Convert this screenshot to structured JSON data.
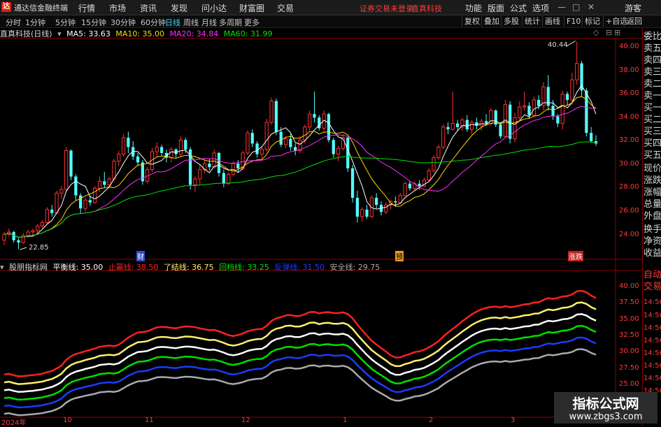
{
  "menubar": {
    "logo_glyph": "达",
    "app_title": "通达信金融终端",
    "items": [
      "行情",
      "市场",
      "资讯",
      "发现",
      "问小达",
      "财富圈",
      "交易"
    ],
    "alert_1": "证券交易未登录",
    "alert_2": "直真科技",
    "right_items": [
      "功能",
      "版面",
      "公式",
      "选项"
    ],
    "user": "游客",
    "win_min": "—",
    "win_max": "□",
    "win_close": "✕"
  },
  "toolbar": {
    "timeframes": [
      "分时",
      "1分钟",
      "5分钟",
      "15分钟",
      "30分钟",
      "60分钟",
      "日线",
      "周线",
      "月线",
      "多周期",
      "更多"
    ],
    "active": "日线",
    "right_buttons": [
      "复权",
      "叠加",
      "多股",
      "统计",
      "画线",
      "F10",
      "标记",
      "+自选",
      "返回"
    ]
  },
  "main_header": {
    "title": "直真科技(日线)",
    "ma5": "MA5: 33.63",
    "ma10": "MA10: 35.00",
    "ma20": "MA20: 34.84",
    "ma60": "MA60: 31.99",
    "colors": {
      "ma5": "#ffffff",
      "ma10": "#ffd700",
      "ma20": "#ff2bff",
      "ma60": "#00e000"
    }
  },
  "price_axis": [
    "40.00",
    "38.00",
    "36.00",
    "34.00",
    "32.00",
    "30.00",
    "28.00",
    "26.00",
    "24.00"
  ],
  "annotations": {
    "high": "40.44",
    "low": "22.85",
    "marker_1": "财",
    "marker_2": "预",
    "marker_3": "涨跌"
  },
  "sub_header": {
    "title": "股朋指标网",
    "balance": "平衡线: 35.00",
    "stop_profit": "止赢线: 38.50",
    "close_out": "了结线: 36.75",
    "pullback": "回档线: 33.25",
    "rebound": "反弹线: 31.50",
    "safe": "安全线: 29.75",
    "colors": {
      "stop_profit": "#ff2020",
      "close_out": "#ffef6a",
      "balance": "#ffffff",
      "pullback": "#00e000",
      "rebound": "#1a3cff",
      "safe": "#aaaaaa"
    }
  },
  "sub_axis": [
    "40.00",
    "37.50",
    "35.00",
    "32.50",
    "30.00",
    "27.50",
    "25.00"
  ],
  "right_panel": {
    "items": [
      "委比",
      "卖五",
      "卖四",
      "卖三",
      "卖二",
      "卖一",
      "买一",
      "买二",
      "买三",
      "买四",
      "买五",
      "现价",
      "涨跌",
      "涨幅",
      "总量",
      "外盘",
      "换手",
      "净资",
      "收益"
    ],
    "bottom_items": [
      "自动",
      "交易"
    ],
    "time_labels": [
      "14:56",
      "14:56",
      "14:56",
      "14:56",
      "14:56",
      "14:56",
      "14:56",
      "14:56"
    ]
  },
  "date_axis": [
    "2024年",
    "10",
    "11",
    "12",
    "1",
    "2",
    "3"
  ],
  "watermark": {
    "line1": "指标公式网",
    "line2": "www.zbgs3.com"
  },
  "chart_data": {
    "type": "candlestick",
    "title": "直真科技(日线)",
    "y_range": [
      23,
      41
    ],
    "candles": [
      [
        23.6,
        24.3,
        23.2,
        24.1
      ],
      [
        24.1,
        24.6,
        23.9,
        24.3
      ],
      [
        24.3,
        24.4,
        23.4,
        23.6
      ],
      [
        23.6,
        23.8,
        22.85,
        23.4
      ],
      [
        23.4,
        24.2,
        23.3,
        24.0
      ],
      [
        24.0,
        24.5,
        23.8,
        24.3
      ],
      [
        24.3,
        24.6,
        24.0,
        24.4
      ],
      [
        24.4,
        25.0,
        24.2,
        24.8
      ],
      [
        24.8,
        25.3,
        24.6,
        25.1
      ],
      [
        25.1,
        26.4,
        25.0,
        26.2
      ],
      [
        26.2,
        26.6,
        25.6,
        25.9
      ],
      [
        25.9,
        27.8,
        25.8,
        27.6
      ],
      [
        27.6,
        28.2,
        27.1,
        27.9
      ],
      [
        27.9,
        31.5,
        27.7,
        31.2
      ],
      [
        31.2,
        31.3,
        28.7,
        29.0
      ],
      [
        29.0,
        29.2,
        27.0,
        27.4
      ],
      [
        27.4,
        27.6,
        25.9,
        26.3
      ],
      [
        26.3,
        27.2,
        26.0,
        27.0
      ],
      [
        27.0,
        27.4,
        26.5,
        26.8
      ],
      [
        26.8,
        28.2,
        26.7,
        28.0
      ],
      [
        28.0,
        29.0,
        27.7,
        28.6
      ],
      [
        28.6,
        29.4,
        28.0,
        28.3
      ],
      [
        28.3,
        29.0,
        28.0,
        28.8
      ],
      [
        28.8,
        30.5,
        28.6,
        30.3
      ],
      [
        30.3,
        31.2,
        29.9,
        30.9
      ],
      [
        30.9,
        32.6,
        30.7,
        32.3
      ],
      [
        32.3,
        32.8,
        31.0,
        31.5
      ],
      [
        31.5,
        32.0,
        30.4,
        30.7
      ],
      [
        30.7,
        31.0,
        29.9,
        30.2
      ],
      [
        30.2,
        30.4,
        28.3,
        28.6
      ],
      [
        28.6,
        29.8,
        28.4,
        29.6
      ],
      [
        29.6,
        31.4,
        29.4,
        31.1
      ],
      [
        31.1,
        31.9,
        30.7,
        31.5
      ],
      [
        31.5,
        31.7,
        30.8,
        31.0
      ],
      [
        31.0,
        31.3,
        30.2,
        30.6
      ],
      [
        30.6,
        31.5,
        30.2,
        31.3
      ],
      [
        31.3,
        31.4,
        30.6,
        30.9
      ],
      [
        30.9,
        32.4,
        30.7,
        32.1
      ],
      [
        32.1,
        32.3,
        31.0,
        31.3
      ],
      [
        31.3,
        31.5,
        27.9,
        28.3
      ],
      [
        28.3,
        29.0,
        27.7,
        28.8
      ],
      [
        28.8,
        30.0,
        28.3,
        29.6
      ],
      [
        29.6,
        30.4,
        29.3,
        30.1
      ],
      [
        30.1,
        30.5,
        29.5,
        29.8
      ],
      [
        29.8,
        31.3,
        29.7,
        31.0
      ],
      [
        31.0,
        31.1,
        29.0,
        29.3
      ],
      [
        29.3,
        29.6,
        28.1,
        28.4
      ],
      [
        28.4,
        29.4,
        28.3,
        29.2
      ],
      [
        29.2,
        30.3,
        29.0,
        30.1
      ],
      [
        30.1,
        30.4,
        29.4,
        29.7
      ],
      [
        29.7,
        31.2,
        29.5,
        31.0
      ],
      [
        31.0,
        32.9,
        30.8,
        32.7
      ],
      [
        32.7,
        33.0,
        31.5,
        31.8
      ],
      [
        31.8,
        32.0,
        30.6,
        30.9
      ],
      [
        30.9,
        31.5,
        30.5,
        31.3
      ],
      [
        31.3,
        33.9,
        31.1,
        33.6
      ],
      [
        33.6,
        35.7,
        33.4,
        35.4
      ],
      [
        35.4,
        35.6,
        32.5,
        32.8
      ],
      [
        32.8,
        33.2,
        31.5,
        31.7
      ],
      [
        31.7,
        32.4,
        31.4,
        32.2
      ],
      [
        32.2,
        32.6,
        31.2,
        31.5
      ],
      [
        31.5,
        31.8,
        30.8,
        31.2
      ],
      [
        31.2,
        32.4,
        31.0,
        32.1
      ],
      [
        32.1,
        33.4,
        31.8,
        33.2
      ],
      [
        33.2,
        34.6,
        32.9,
        34.3
      ],
      [
        34.3,
        36.2,
        33.6,
        34.0
      ],
      [
        34.0,
        34.2,
        32.9,
        33.1
      ],
      [
        33.1,
        34.6,
        32.8,
        34.3
      ],
      [
        34.3,
        34.4,
        31.9,
        32.1
      ],
      [
        32.1,
        32.3,
        30.6,
        30.9
      ],
      [
        30.9,
        31.6,
        30.3,
        31.4
      ],
      [
        31.4,
        32.6,
        31.2,
        32.3
      ],
      [
        32.3,
        32.4,
        29.4,
        29.7
      ],
      [
        29.7,
        30.0,
        26.8,
        27.2
      ],
      [
        27.2,
        27.8,
        25.1,
        25.6
      ],
      [
        25.6,
        26.4,
        25.2,
        26.2
      ],
      [
        26.2,
        26.6,
        25.4,
        25.6
      ],
      [
        25.6,
        27.4,
        25.5,
        27.2
      ],
      [
        27.2,
        27.6,
        26.3,
        26.6
      ],
      [
        26.6,
        26.9,
        25.7,
        26.0
      ],
      [
        26.0,
        26.8,
        25.8,
        26.6
      ],
      [
        26.6,
        27.0,
        26.2,
        26.9
      ],
      [
        26.9,
        27.3,
        26.5,
        26.8
      ],
      [
        26.8,
        27.6,
        26.7,
        27.4
      ],
      [
        27.4,
        28.6,
        27.3,
        28.4
      ],
      [
        28.4,
        28.6,
        27.8,
        28.0
      ],
      [
        28.0,
        28.6,
        27.8,
        28.4
      ],
      [
        28.4,
        28.7,
        27.9,
        28.2
      ],
      [
        28.2,
        28.9,
        28.1,
        28.7
      ],
      [
        28.7,
        29.7,
        28.6,
        29.5
      ],
      [
        29.5,
        30.8,
        29.3,
        30.6
      ],
      [
        30.6,
        31.7,
        30.4,
        31.5
      ],
      [
        31.5,
        33.4,
        31.3,
        33.2
      ],
      [
        33.2,
        33.6,
        32.6,
        33.0
      ],
      [
        33.0,
        36.2,
        32.9,
        33.5
      ],
      [
        33.5,
        33.8,
        32.9,
        33.2
      ],
      [
        33.2,
        34.0,
        32.9,
        33.8
      ],
      [
        33.8,
        34.2,
        32.8,
        33.0
      ],
      [
        33.0,
        33.8,
        32.6,
        33.6
      ],
      [
        33.6,
        34.0,
        33.0,
        33.3
      ],
      [
        33.3,
        33.9,
        32.9,
        33.7
      ],
      [
        33.7,
        34.3,
        33.3,
        33.5
      ],
      [
        33.5,
        34.8,
        33.3,
        34.6
      ],
      [
        34.6,
        34.7,
        33.2,
        33.4
      ],
      [
        33.4,
        33.6,
        32.2,
        32.4
      ],
      [
        32.4,
        35.5,
        32.3,
        35.1
      ],
      [
        35.1,
        35.4,
        31.8,
        32.2
      ],
      [
        32.2,
        34.4,
        31.9,
        34.0
      ],
      [
        34.0,
        35.4,
        33.7,
        34.9
      ],
      [
        34.9,
        36.2,
        34.6,
        35.0
      ],
      [
        35.0,
        35.3,
        33.9,
        34.2
      ],
      [
        34.2,
        35.8,
        34.0,
        35.5
      ],
      [
        35.5,
        35.9,
        34.7,
        35.0
      ],
      [
        35.0,
        37.0,
        34.6,
        36.6
      ],
      [
        36.6,
        37.6,
        34.6,
        35.0
      ],
      [
        35.0,
        35.5,
        33.8,
        34.1
      ],
      [
        34.1,
        34.3,
        33.2,
        33.5
      ],
      [
        33.5,
        36.3,
        33.0,
        36.0
      ],
      [
        36.0,
        36.2,
        35.0,
        35.5
      ],
      [
        35.5,
        37.8,
        35.1,
        37.2
      ],
      [
        37.2,
        40.44,
        36.8,
        38.6
      ],
      [
        38.6,
        38.8,
        35.8,
        36.3
      ],
      [
        36.3,
        36.5,
        32.4,
        32.7
      ],
      [
        32.7,
        33.2,
        31.9,
        32.0
      ],
      [
        32.0,
        32.5,
        31.6,
        31.8
      ]
    ]
  }
}
